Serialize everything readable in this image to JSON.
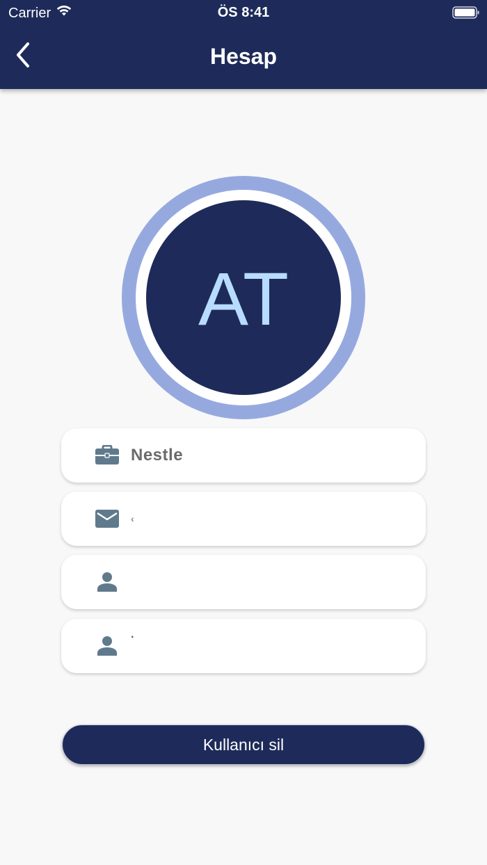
{
  "status_bar": {
    "carrier": "Carrier",
    "time": "ÖS 8:41",
    "icons": [
      "wifi-icon",
      "battery-icon"
    ]
  },
  "header": {
    "title": "Hesap",
    "back_icon": "chevron-left-icon",
    "background": "#1e2b5a"
  },
  "avatar": {
    "initials": "AT",
    "ring_color": "#96a9df",
    "core_color": "#1e2b5a",
    "initials_color": "#b8dcff"
  },
  "fields": [
    {
      "icon": "briefcase-icon",
      "value": "Nestle"
    },
    {
      "icon": "mail-icon",
      "value": "‹"
    },
    {
      "icon": "person-icon",
      "value": ""
    },
    {
      "icon": "person-icon",
      "value": "·"
    }
  ],
  "actions": {
    "delete_user_label": "Kullanıcı sil"
  },
  "colors": {
    "primary": "#1e2b5a",
    "icon": "#5f7a8c",
    "background": "#f8f8f8"
  }
}
